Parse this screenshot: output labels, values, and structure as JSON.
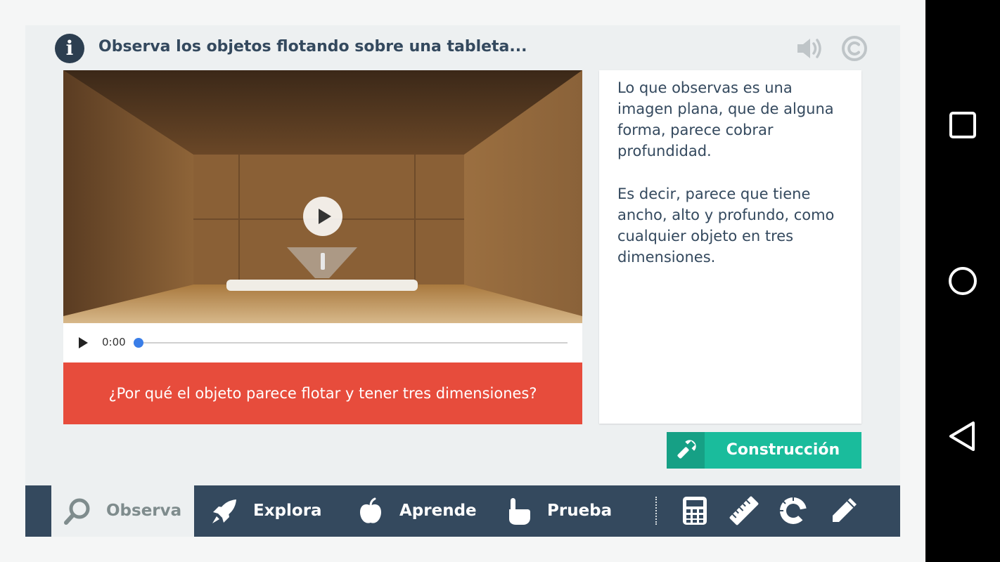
{
  "header": {
    "title": "Observa los objetos flotando sobre una tableta...",
    "info_icon": "info-icon",
    "info_glyph": "i",
    "sound_icon": "speaker-icon",
    "credits_icon": "copyright-icon"
  },
  "video": {
    "time": "0:00",
    "progress": 0,
    "play_icon": "play-icon"
  },
  "question": "¿Por qué el objeto parece flotar y tener tres dimensiones?",
  "explanation": {
    "paragraph1": "Lo que observas es una imagen plana, que de alguna forma, parece cobrar profundidad.",
    "paragraph2": "Es decir, parece que tiene ancho, alto y profundo, como cualquier objeto en tres dimensiones."
  },
  "build_button": {
    "label": "Construcción",
    "icon": "wrench-icon"
  },
  "tabs": [
    {
      "label": "Observa",
      "icon": "magnifier-icon",
      "active": true
    },
    {
      "label": "Explora",
      "icon": "rocket-icon",
      "active": false
    },
    {
      "label": "Aprende",
      "icon": "apple-icon",
      "active": false
    },
    {
      "label": "Prueba",
      "icon": "pointing-hand-icon",
      "active": false
    }
  ],
  "tools": [
    "calculator-icon",
    "ruler-icon",
    "protractor-icon",
    "pencil-icon"
  ],
  "android_nav": [
    "recents-button",
    "home-button",
    "back-button"
  ],
  "colors": {
    "accent_red": "#e74c3c",
    "accent_teal": "#1abc9c",
    "dark_teal": "#16a085",
    "navy": "#34495e",
    "background": "#edf0f1"
  }
}
